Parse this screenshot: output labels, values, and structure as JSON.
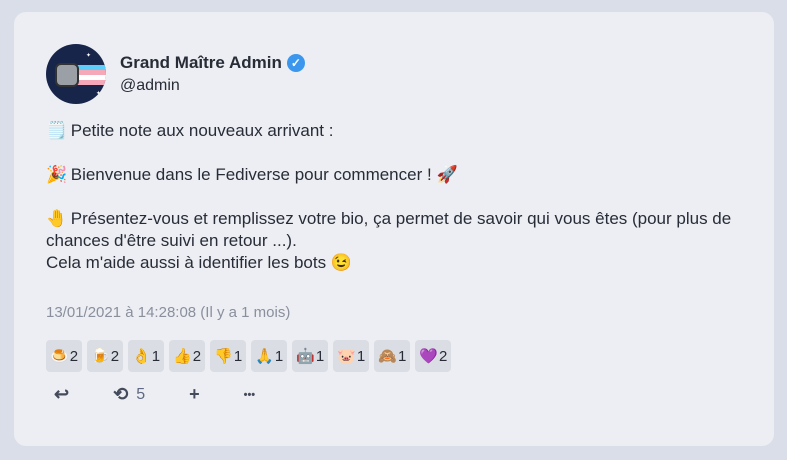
{
  "account": {
    "display_name": "Grand Maître Admin",
    "verified_glyph": "✓",
    "handle": "@admin"
  },
  "content": {
    "line1_emoji": "🗒️",
    "line1": "Petite note aux nouveaux arrivant :",
    "line2_emoji": "🎉",
    "line2": "Bienvenue dans le Fediverse pour commencer !",
    "line2_end_emoji": "🚀",
    "line3_emoji": "🤚",
    "line3": "Présentez-vous et remplissez votre bio, ça permet de savoir qui vous êtes (pour plus de chances d'être suivi en retour ...).",
    "line4": "Cela m'aide aussi à identifier les bots",
    "line4_end_emoji": "😉"
  },
  "timestamp": "13/01/2021 à 14:28:08 (Il y a 1 mois)",
  "reactions": [
    {
      "icon": "🍮",
      "name": "pudding",
      "count": "2"
    },
    {
      "icon": "🍺",
      "name": "beer",
      "count": "2"
    },
    {
      "icon": "👌",
      "name": "ok-hand",
      "count": "1"
    },
    {
      "icon": "👍",
      "name": "thumbs-up",
      "count": "2"
    },
    {
      "icon": "👎",
      "name": "thumbs-down",
      "count": "1"
    },
    {
      "icon": "🙏",
      "name": "folded-hands",
      "count": "1"
    },
    {
      "icon": "🤖",
      "name": "robot",
      "count": "1"
    },
    {
      "icon": "🐷",
      "name": "pig",
      "count": "1"
    },
    {
      "icon": "🙈",
      "name": "monkey",
      "count": "1"
    },
    {
      "icon": "💜",
      "name": "rainbow-heart",
      "count": "2"
    }
  ],
  "actions": {
    "reply_icon": "↩",
    "boost_icon": "⟲",
    "boost_count": "5",
    "add_icon": "+",
    "more_icon": "•••"
  }
}
